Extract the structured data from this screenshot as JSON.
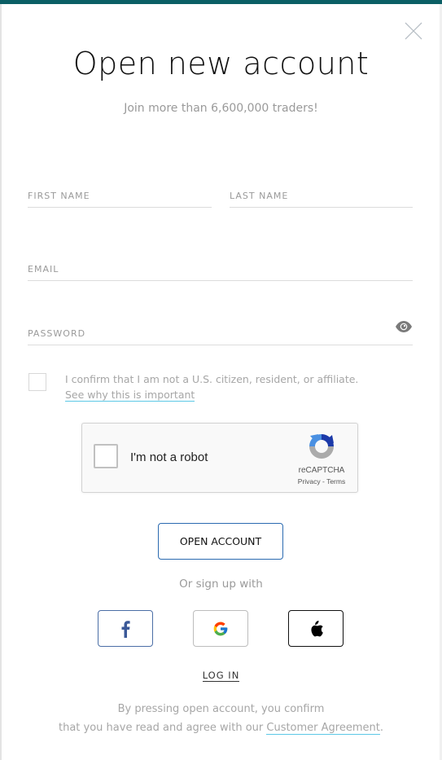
{
  "header": {
    "accent_color": "#0b5f65",
    "close_icon": "close-icon",
    "title": "Open new account",
    "subtitle": "Join more than 6,600,000 traders!"
  },
  "form": {
    "first_name": {
      "placeholder": "FIRST NAME",
      "value": ""
    },
    "last_name": {
      "placeholder": "LAST NAME",
      "value": ""
    },
    "email": {
      "placeholder": "EMAIL",
      "value": ""
    },
    "password": {
      "placeholder": "PASSWORD",
      "value": "",
      "toggle_icon": "eye-icon"
    },
    "confirm": {
      "checked": false,
      "text": "I confirm that I am not a U.S. citizen, resident, or affiliate.",
      "link": "See why this is important"
    }
  },
  "recaptcha": {
    "label": "I'm not a robot",
    "brand": "reCAPTCHA",
    "privacy": "Privacy",
    "separator": " - ",
    "terms": "Terms"
  },
  "actions": {
    "open_account": "OPEN ACCOUNT",
    "or_sign_up": "Or sign up with",
    "social": [
      {
        "name": "facebook",
        "icon": "facebook-icon",
        "color": "#3b5998"
      },
      {
        "name": "google",
        "icon": "google-icon"
      },
      {
        "name": "apple",
        "icon": "apple-icon",
        "color": "#000000"
      }
    ],
    "login": "LOG IN"
  },
  "legal": {
    "line1": "By pressing open account, you confirm",
    "line2_prefix": "that you have read and agree with our ",
    "agreement_link": "Customer Agreement",
    "line2_suffix": "."
  }
}
